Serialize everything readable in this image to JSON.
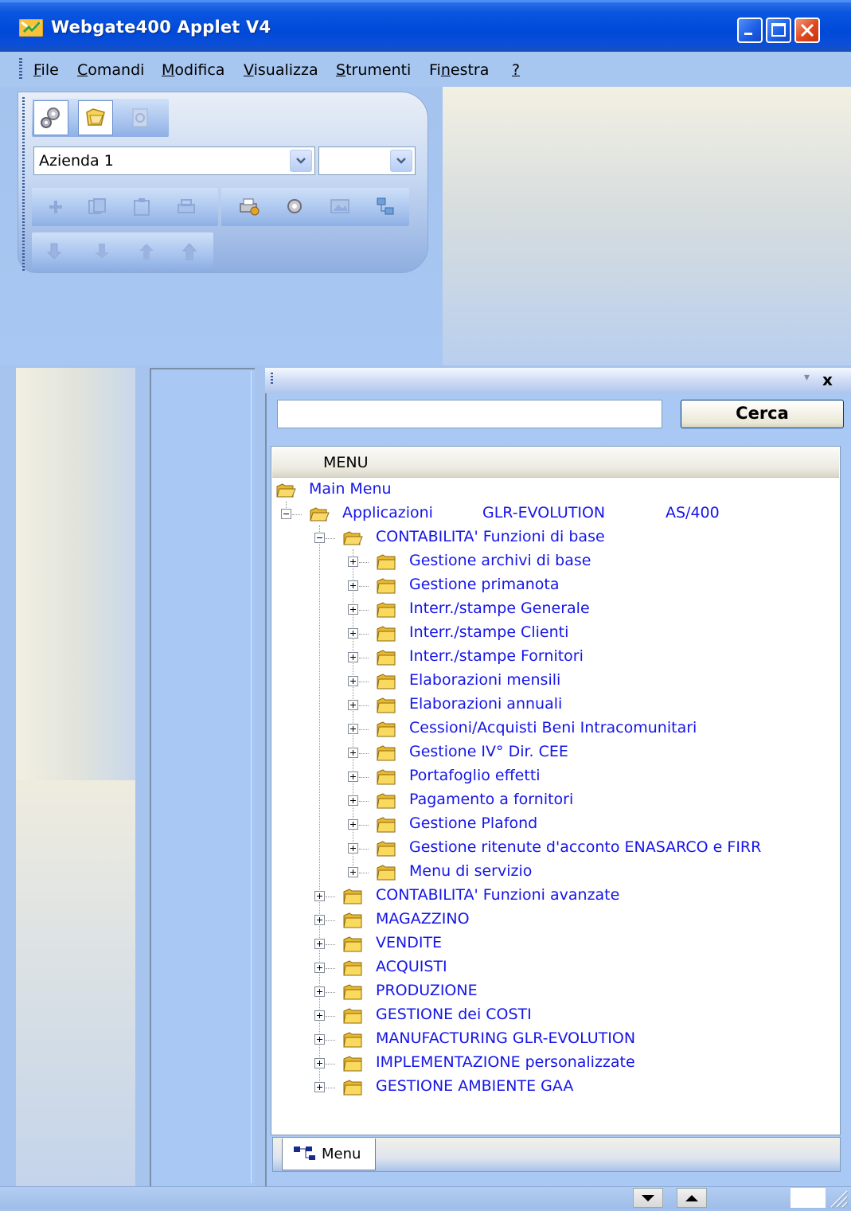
{
  "window": {
    "title": "Webgate400 Applet V4",
    "minimize_icon": "minimize-icon",
    "maximize_icon": "maximize-icon",
    "close_icon": "close-icon"
  },
  "menubar": {
    "items": [
      {
        "label": "File",
        "key": "F",
        "rest": "ile"
      },
      {
        "label": "Comandi",
        "key": "C",
        "rest": "omandi"
      },
      {
        "label": "Modifica",
        "key": "M",
        "rest": "odifica"
      },
      {
        "label": "Visualizza",
        "key": "V",
        "rest": "isualizza"
      },
      {
        "label": "Strumenti",
        "key": "S",
        "rest": "trumenti"
      },
      {
        "label": "Finestra",
        "pre": "Fi",
        "key": "n",
        "rest": "estra"
      },
      {
        "label": "?",
        "key": "?",
        "rest": ""
      }
    ]
  },
  "toolbar": {
    "company_select": {
      "value": "Azienda 1"
    },
    "second_select": {
      "value": ""
    },
    "icons": [
      "gears-icon",
      "folders-icon",
      "preview-icon",
      "add-icon",
      "copy-icon",
      "paste-icon",
      "print-icon",
      "printer-settings-icon",
      "settings-icon",
      "image-icon",
      "network-icon",
      "move-down-icon",
      "arrow-down-icon",
      "arrow-up-icon",
      "move-up-icon"
    ]
  },
  "search": {
    "value": "",
    "button_label": "Cerca"
  },
  "tree": {
    "header": "MENU",
    "root": "Main Menu",
    "applicazioni": {
      "c1": "Applicazioni",
      "c2": "GLR-EVOLUTION",
      "c3": "AS/400"
    },
    "contabilita_base": "CONTABILITA' Funzioni di base",
    "contabilita_children": [
      "Gestione archivi di base",
      "Gestione primanota",
      "Interr./stampe Generale",
      "Interr./stampe Clienti",
      "Interr./stampe Fornitori",
      "Elaborazioni mensili",
      "Elaborazioni annuali",
      "Cessioni/Acquisti Beni Intracomunitari",
      "Gestione IV° Dir. CEE",
      "Portafoglio effetti",
      "Pagamento a fornitori",
      "Gestione Plafond",
      "Gestione ritenute d'acconto ENASARCO e FIRR",
      "Menu di servizio"
    ],
    "app_children": [
      "CONTABILITA' Funzioni avanzate",
      "MAGAZZINO",
      "VENDITE",
      "ACQUISTI",
      "PRODUZIONE",
      "GESTIONE dei COSTI",
      "MANUFACTURING GLR-EVOLUTION",
      "IMPLEMENTAZIONE personalizzate",
      "GESTIONE AMBIENTE GAA"
    ]
  },
  "tabs": {
    "menu_label": "Menu"
  },
  "dock": {
    "close_label": "x"
  },
  "colors": {
    "title_blue": "#0a56e0",
    "link_blue": "#1515e8",
    "workspace": "#a8c8f4"
  }
}
